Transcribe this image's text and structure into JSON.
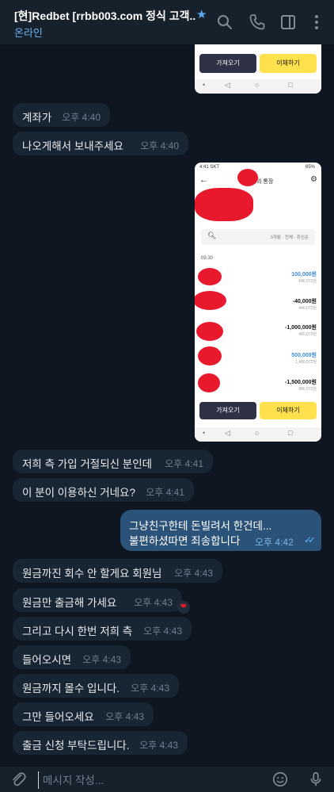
{
  "header": {
    "title": "[현]Redbet [rrbb003.com 정식 고객...",
    "status": "온라인",
    "icons": [
      "star-icon",
      "search-icon",
      "phone-icon",
      "sidebar-toggle-icon",
      "more-vertical-icon"
    ]
  },
  "screenshot1": {
    "left_button": "가져오기",
    "right_button": "이체하기"
  },
  "screenshot2": {
    "status_time": "4:41 SKT",
    "battery": "65%",
    "title": "의 통장",
    "filter": "3개월 · 전체 · 최신순",
    "date": "09.30",
    "transactions": [
      {
        "amount": "100,000원",
        "balance": "540,072원",
        "color": "#3a8fd6"
      },
      {
        "amount": "-40,000원",
        "balance": "440,072원",
        "color": "#111111"
      },
      {
        "amount": "-1,000,000원",
        "balance": "480,072원",
        "color": "#111111"
      },
      {
        "amount": "500,000원",
        "balance": "1,480,072원",
        "color": "#3a8fd6"
      },
      {
        "amount": "-1,500,000원",
        "balance": "980,072원",
        "color": "#111111"
      }
    ],
    "left_button": "가져오기",
    "right_button": "이체하기"
  },
  "messages_in_1": [
    {
      "text": "계좌가",
      "time": "오후 4:40"
    },
    {
      "text": "나오게해서 보내주세요",
      "time": "오후 4:40"
    }
  ],
  "messages_in_2": [
    {
      "text": "저희 측 가입 거절되신 분인데",
      "time": "오후 4:41"
    },
    {
      "text": "이 분이 이용하신 거네요?",
      "time": "오후 4:41"
    }
  ],
  "message_out": {
    "line1": "그냥친구한테 돈빌려서 한건데...",
    "line2": "불편하셨따면 죄송합니다",
    "time": "오후 4:42"
  },
  "messages_in_3": [
    {
      "text": "원금까진 회수 안 할게요 회원님",
      "time": "오후 4:43"
    },
    {
      "text": "원금만 출금해 가세요",
      "time": "오후 4:43"
    },
    {
      "text": "그리고 다시 한번 저희 측",
      "time": "오후 4:43"
    },
    {
      "text": "들어오시면",
      "time": "오후 4:43"
    },
    {
      "text": "원금까지 몰수 입니다.",
      "time": "오후 4:43"
    },
    {
      "text": "그만 들어오세요",
      "time": "오후 4:43"
    },
    {
      "text": "출금 신청 부탁드립니다.",
      "time": "오후 4:43"
    }
  ],
  "reaction": "❤",
  "composer": {
    "placeholder": "메시지 작성...",
    "icons": [
      "attach-icon",
      "emoji-icon",
      "microphone-icon"
    ]
  },
  "colors": {
    "background": "#0e1621",
    "header": "#17212b",
    "incoming_bubble": "#182533",
    "outgoing_bubble": "#2b5278",
    "accent": "#6ab2f2",
    "redaction": "#e8192c"
  }
}
